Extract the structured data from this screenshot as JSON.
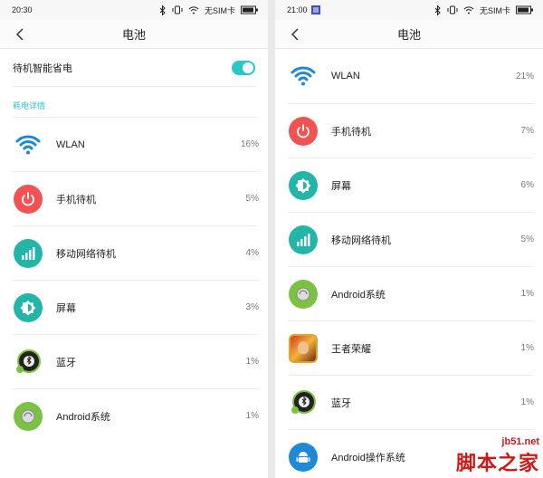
{
  "left": {
    "status": {
      "time": "20:30",
      "sim": "无SIM卡"
    },
    "title": "电池",
    "toggle": {
      "label": "待机智能省电",
      "on": true
    },
    "section": "耗电详情",
    "items": [
      {
        "name": "WLAN",
        "percent": "16%",
        "icon": "wifi-icon"
      },
      {
        "name": "手机待机",
        "percent": "5%",
        "icon": "power-icon"
      },
      {
        "name": "移动网络待机",
        "percent": "4%",
        "icon": "signal-icon"
      },
      {
        "name": "屏幕",
        "percent": "3%",
        "icon": "brightness-icon"
      },
      {
        "name": "蓝牙",
        "percent": "1%",
        "icon": "bluetooth-icon"
      },
      {
        "name": "Android系统",
        "percent": "1%",
        "icon": "android-system-icon"
      }
    ]
  },
  "right": {
    "status": {
      "time": "21:00",
      "sim": "无SIM卡"
    },
    "title": "电池",
    "items": [
      {
        "name": "WLAN",
        "percent": "21%",
        "icon": "wifi-icon"
      },
      {
        "name": "手机待机",
        "percent": "7%",
        "icon": "power-icon"
      },
      {
        "name": "屏幕",
        "percent": "6%",
        "icon": "brightness-icon"
      },
      {
        "name": "移动网络待机",
        "percent": "5%",
        "icon": "signal-icon"
      },
      {
        "name": "Android系统",
        "percent": "1%",
        "icon": "android-system-icon"
      },
      {
        "name": "王者荣耀",
        "percent": "1%",
        "icon": "game-icon"
      },
      {
        "name": "蓝牙",
        "percent": "1%",
        "icon": "bluetooth-icon"
      },
      {
        "name": "Android操作系统",
        "percent": "",
        "icon": "android-os-icon"
      }
    ]
  },
  "watermark": {
    "site": "jb51.net",
    "text": "脚本之家"
  },
  "colors": {
    "accent": "#2ac7c9",
    "teal": "#22b6a8",
    "red": "#f25252",
    "android": "#7cc242"
  }
}
